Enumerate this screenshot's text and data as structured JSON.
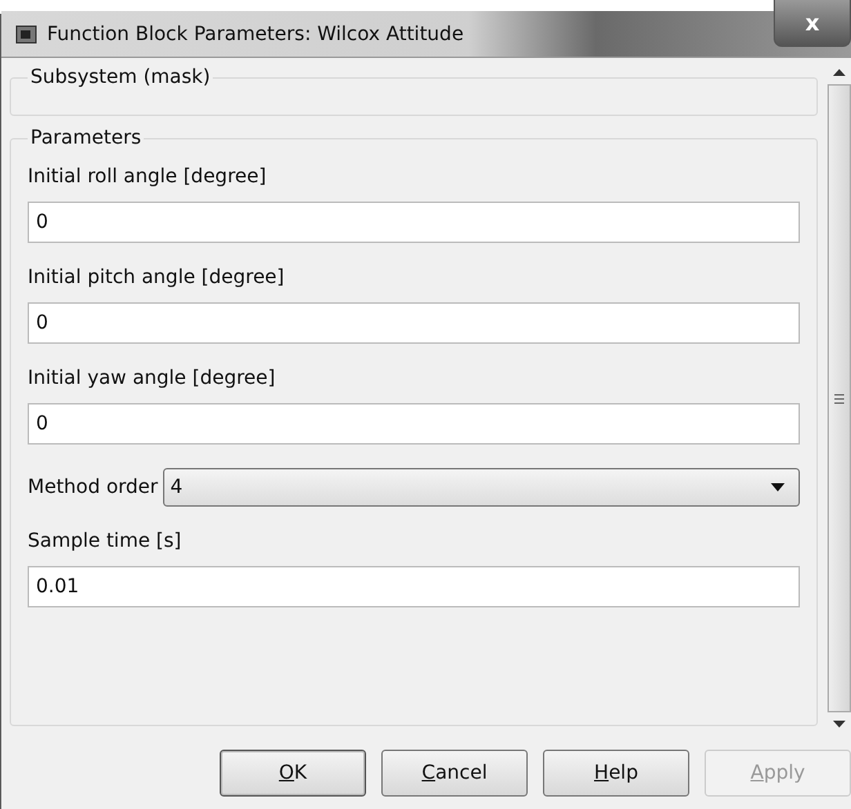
{
  "window": {
    "title": "Function Block Parameters: Wilcox Attitude",
    "close": "x"
  },
  "mask_group": {
    "title": "Subsystem (mask)"
  },
  "parameters_group": {
    "title": "Parameters"
  },
  "parameters": [
    {
      "kind": "text",
      "label": "Initial roll angle [degree]",
      "value": "0"
    },
    {
      "kind": "text",
      "label": "Initial pitch angle [degree]",
      "value": "0"
    },
    {
      "kind": "text",
      "label": "Initial yaw angle [degree]",
      "value": "0"
    },
    {
      "kind": "dropdown",
      "label": "Method order",
      "value": "4"
    },
    {
      "kind": "text",
      "label": "Sample time [s]",
      "value": "0.01"
    }
  ],
  "buttons": [
    {
      "key": "O",
      "rest": "K",
      "disabled": false,
      "default": true
    },
    {
      "key": "C",
      "rest": "ancel",
      "disabled": false,
      "default": false
    },
    {
      "key": "H",
      "rest": "elp",
      "disabled": false,
      "default": false
    },
    {
      "key": "A",
      "rest": "pply",
      "disabled": true,
      "default": false
    }
  ]
}
